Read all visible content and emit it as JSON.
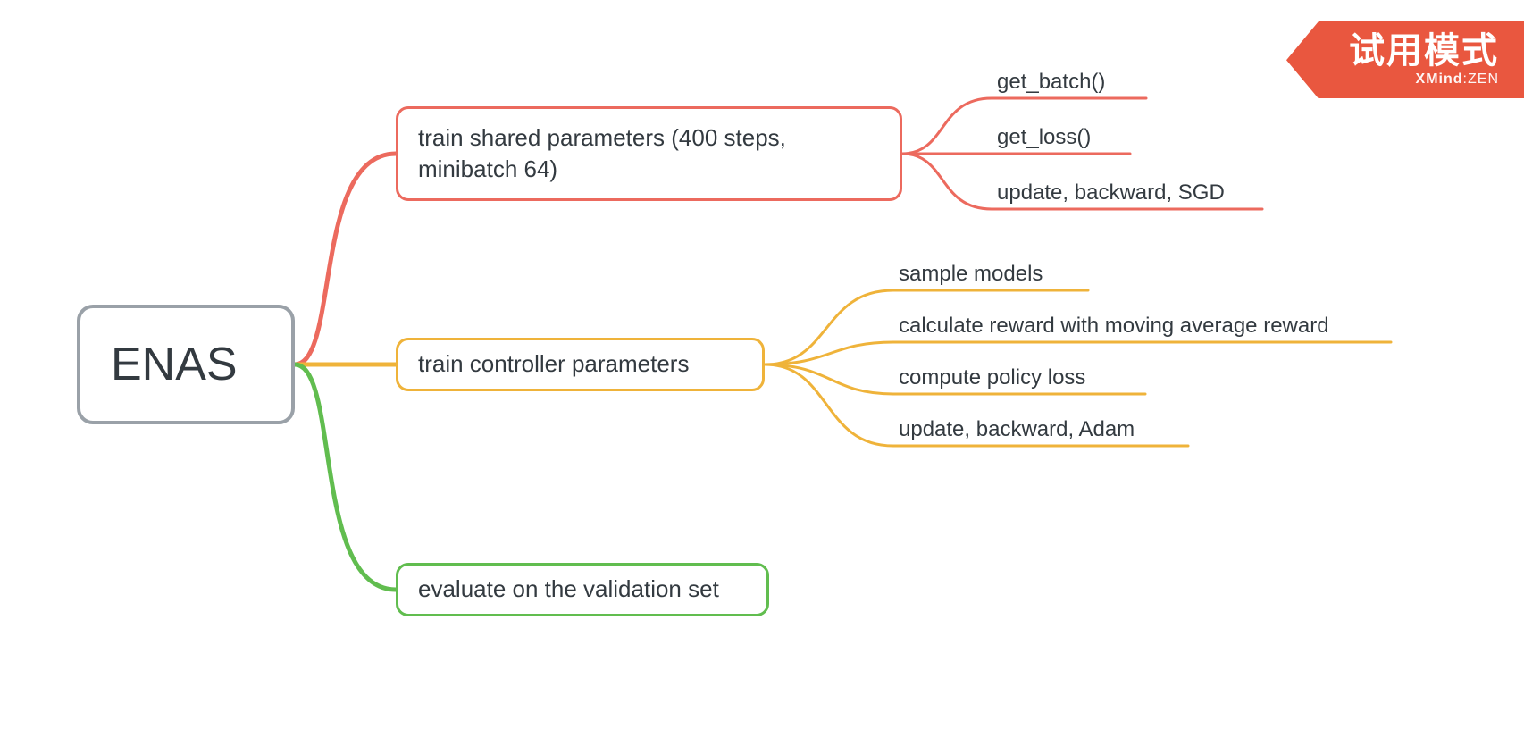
{
  "colors": {
    "red": "#ec6a5e",
    "yellow": "#efb33a",
    "green": "#61bd4f",
    "rootBorder": "#9aa1a8",
    "watermarkBg": "#e9573f"
  },
  "root": {
    "label": "ENAS"
  },
  "branches": [
    {
      "label": "train shared parameters (400 steps, minibatch 64)",
      "color": "red",
      "leaves": [
        "get_batch()",
        "get_loss()",
        "update, backward, SGD"
      ]
    },
    {
      "label": "train controller parameters",
      "color": "yellow",
      "leaves": [
        "sample models",
        "calculate reward with moving average reward",
        "compute policy loss",
        "update, backward, Adam"
      ]
    },
    {
      "label": "evaluate on the validation set",
      "color": "green",
      "leaves": []
    }
  ],
  "watermark": {
    "title": "试用模式",
    "brand_bold": "XMind",
    "brand_light": ":ZEN"
  }
}
